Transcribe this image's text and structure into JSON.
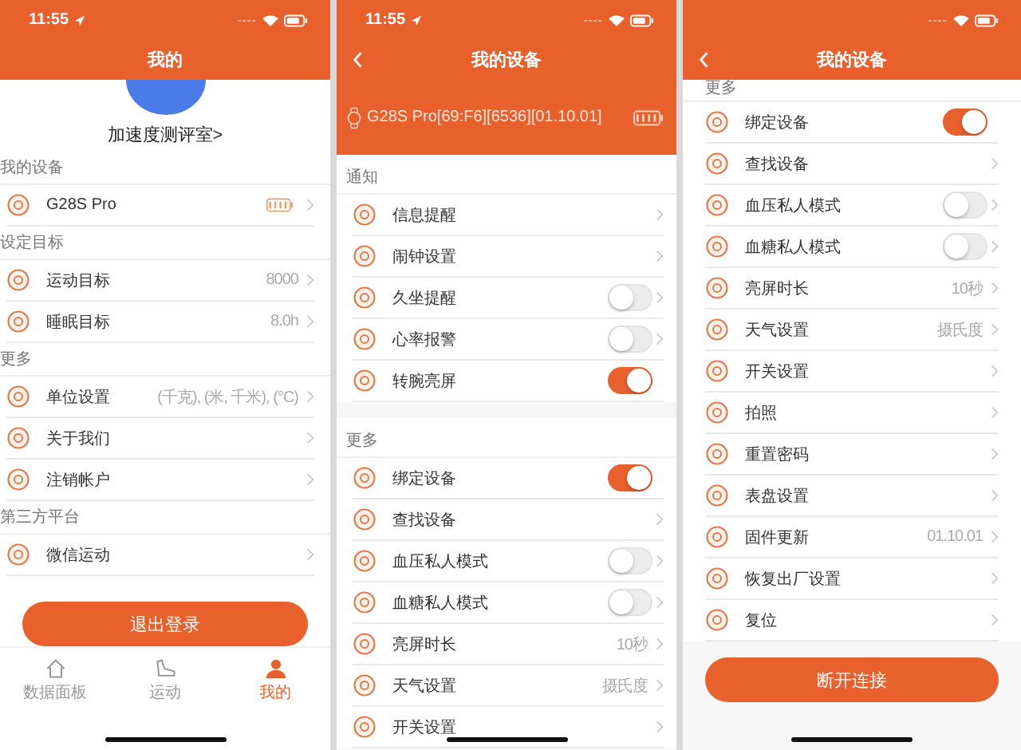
{
  "screens": [
    {
      "status": {
        "time": "11:55"
      },
      "header": {
        "title": "我的",
        "back": false
      },
      "profile": {
        "name": "加速度测评室>"
      },
      "sections": [
        {
          "heading": "我的设备",
          "rows": [
            {
              "kind": "device",
              "label": "G28S Pro"
            }
          ]
        },
        {
          "heading": "设定目标",
          "rows": [
            {
              "kind": "link",
              "label": "运动目标",
              "value": "8000"
            },
            {
              "kind": "link",
              "label": "睡眠目标",
              "value": "8.0h"
            }
          ]
        },
        {
          "heading": "更多",
          "rows": [
            {
              "kind": "link",
              "label": "单位设置",
              "value": "(千克), (米, 千米), (°C)"
            },
            {
              "kind": "link",
              "label": "关于我们"
            },
            {
              "kind": "link",
              "label": "注销帐户"
            }
          ]
        },
        {
          "heading": "第三方平台",
          "rows": [
            {
              "kind": "link",
              "label": "微信运动"
            }
          ]
        }
      ],
      "button": {
        "label": "退出登录"
      },
      "tab_bar": [
        {
          "label": "数据面板",
          "selected": false
        },
        {
          "label": "运动",
          "selected": false
        },
        {
          "label": "我的",
          "selected": true
        }
      ]
    },
    {
      "status": {
        "time": "11:55"
      },
      "header": {
        "title": "我的设备",
        "back": true
      },
      "device_banner": {
        "text": "G28S Pro[69:F6][6536][01.10.01]"
      },
      "sections": [
        {
          "heading": "通知",
          "rows": [
            {
              "kind": "link",
              "label": "信息提醒"
            },
            {
              "kind": "link",
              "label": "闹钟设置"
            },
            {
              "kind": "toggle",
              "label": "久坐提醒",
              "on": false
            },
            {
              "kind": "toggle",
              "label": "心率报警",
              "on": false
            },
            {
              "kind": "toggle",
              "label": "转腕亮屏",
              "on": true
            }
          ]
        },
        {
          "heading": "更多",
          "rows": [
            {
              "kind": "toggle",
              "label": "绑定设备",
              "on": true
            },
            {
              "kind": "link",
              "label": "查找设备"
            },
            {
              "kind": "toggle",
              "label": "血压私人模式",
              "on": false
            },
            {
              "kind": "toggle",
              "label": "血糖私人模式",
              "on": false
            },
            {
              "kind": "link",
              "label": "亮屏时长",
              "value": "10秒"
            },
            {
              "kind": "link",
              "label": "天气设置",
              "value": "摄氏度"
            },
            {
              "kind": "link",
              "label": "开关设置"
            }
          ]
        }
      ]
    },
    {
      "header": {
        "title": "我的设备",
        "back": true
      },
      "sections": [
        {
          "heading": "更多",
          "rows": [
            {
              "kind": "toggle",
              "label": "绑定设备",
              "on": true
            },
            {
              "kind": "link",
              "label": "查找设备"
            },
            {
              "kind": "toggle",
              "label": "血压私人模式",
              "on": false
            },
            {
              "kind": "toggle",
              "label": "血糖私人模式",
              "on": false
            },
            {
              "kind": "link",
              "label": "亮屏时长",
              "value": "10秒"
            },
            {
              "kind": "link",
              "label": "天气设置",
              "value": "摄氏度"
            },
            {
              "kind": "link",
              "label": "开关设置"
            },
            {
              "kind": "link",
              "label": "拍照"
            },
            {
              "kind": "link",
              "label": "重置密码"
            },
            {
              "kind": "link",
              "label": "表盘设置"
            },
            {
              "kind": "link",
              "label": "固件更新",
              "value": "01.10.01"
            },
            {
              "kind": "link",
              "label": "恢复出厂设置"
            },
            {
              "kind": "link",
              "label": "复位"
            }
          ]
        }
      ],
      "button": {
        "label": "断开连接"
      }
    }
  ]
}
